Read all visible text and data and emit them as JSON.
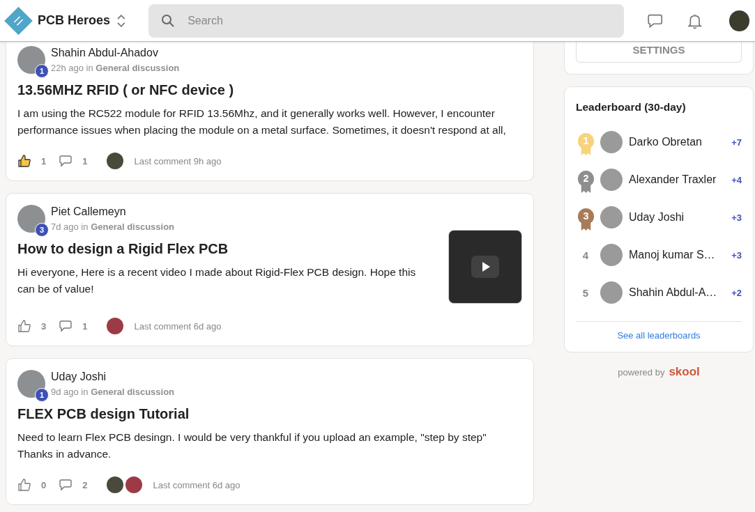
{
  "header": {
    "group_name": "PCB Heroes",
    "search": {
      "placeholder": "Search"
    }
  },
  "posts": [
    {
      "author": "Shahin Abdul-Ahadov",
      "avatar_level": "1",
      "time": "22h ago",
      "in": "in",
      "category": "General discussion",
      "title": "13.56MHZ RFID ( or NFC device )",
      "body": "I am using the RC522 module for RFID 13.56Mhz, and it generally works well. However, I encounter performance issues when placing the module on a metal surface. Sometimes, it doesn't respond at all,",
      "liked": true,
      "likes": "1",
      "comments": "1",
      "commenters": [
        {
          "color": "#4a4a3c"
        }
      ],
      "last_comment": "Last comment 9h ago"
    },
    {
      "author": "Piet Callemeyn",
      "avatar_level": "3",
      "time": "7d ago",
      "in": "in",
      "category": "General discussion",
      "title": "How to design a Rigid Flex PCB",
      "body": "Hi everyone, Here is a recent video I made about Rigid-Flex PCB design. Hope this can be of value!",
      "liked": false,
      "likes": "3",
      "comments": "1",
      "commenters": [
        {
          "color": "#9c3b45"
        }
      ],
      "last_comment": "Last comment 6d ago",
      "attachment": {
        "kind": "video"
      }
    },
    {
      "author": "Uday Joshi",
      "avatar_level": "1",
      "time": "9d ago",
      "in": "in",
      "category": "General discussion",
      "title": "FLEX PCB design Tutorial",
      "body": "Need to learn Flex PCB desingn. I would be very thankful if you upload an example, \"step by step\" Thanks in advance.",
      "liked": false,
      "likes": "0",
      "comments": "2",
      "commenters": [
        {
          "color": "#4a4a3c"
        },
        {
          "color": "#9c3b45"
        }
      ],
      "last_comment": "Last comment 6d ago"
    }
  ],
  "sidebar": {
    "settings_button": "SETTINGS",
    "leaderboard": {
      "title": "Leaderboard (30-day)",
      "entries": [
        {
          "rank": "1",
          "kind": "medal",
          "color": "#f7d37b",
          "name": "Darko Obretan",
          "points": "+7"
        },
        {
          "rank": "2",
          "kind": "medal",
          "color": "#8e8e8e",
          "name": "Alexander Traxler",
          "points": "+4"
        },
        {
          "rank": "3",
          "kind": "medal",
          "color": "#a87c58",
          "name": "Uday Joshi",
          "points": "+3"
        },
        {
          "rank": "4",
          "kind": "plain",
          "name": "Manoj kumar S…",
          "points": "+3"
        },
        {
          "rank": "5",
          "kind": "plain",
          "name": "Shahin Abdul-A…",
          "points": "+2"
        }
      ],
      "link": "See all leaderboards"
    },
    "powered_by": "powered by",
    "brand": "skool"
  }
}
